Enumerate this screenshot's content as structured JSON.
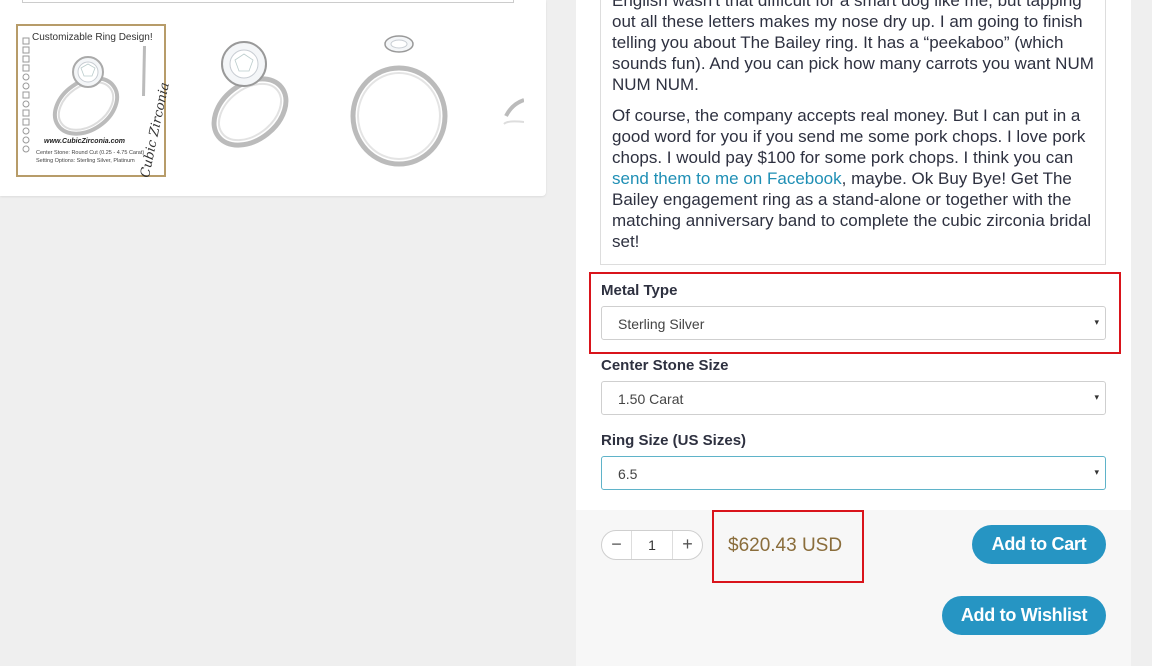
{
  "gallery": {
    "thumb1": {
      "caption": "Customizable Ring Design!",
      "site": "www.CubicZirconia.com",
      "spec_line1": "Center Stone: Round Cut (0.25 - 4.75 Carat)",
      "spec_line2": "Setting Options: Sterling Silver, Platinum",
      "signature": "Cubic Zirconia"
    }
  },
  "description": {
    "paragraph1": "English wasn't that difficult for a smart dog like me, but tapping out all these letters makes my nose dry up. I am going to finish telling you about The Bailey ring. It has a “peekaboo” (which sounds fun). And you can pick how many carrots you want NUM NUM NUM.",
    "paragraph2_before": "Of course, the company accepts real money. But I can put in a good word for you if you send me some pork chops. I love pork chops. I would pay $100 for some pork chops. I think you can ",
    "paragraph2_link": "send them to me on Facebook",
    "paragraph2_after": ", maybe. Ok Buy Bye! Get The Bailey engagement ring as a stand-alone or together with the matching anniversary band to complete the cubic zirconia bridal set!"
  },
  "options": {
    "metal": {
      "label": "Metal Type",
      "value": "Sterling Silver"
    },
    "stone": {
      "label": "Center Stone Size",
      "value": "1.50 Carat"
    },
    "ring": {
      "label": "Ring Size (US Sizes)",
      "value": "6.5"
    },
    "arrow": "▾"
  },
  "purchase": {
    "qty_minus": "−",
    "qty_value": "1",
    "qty_plus": "+",
    "price": "$620.43 USD",
    "add_to_cart": "Add to Cart",
    "add_to_wishlist": "Add to Wishlist"
  },
  "colors": {
    "accent": "#2695c3",
    "price": "#8a6d3b",
    "highlight": "#d9141b",
    "link": "#1f8fb5",
    "thumb_border": "#b79c69"
  }
}
